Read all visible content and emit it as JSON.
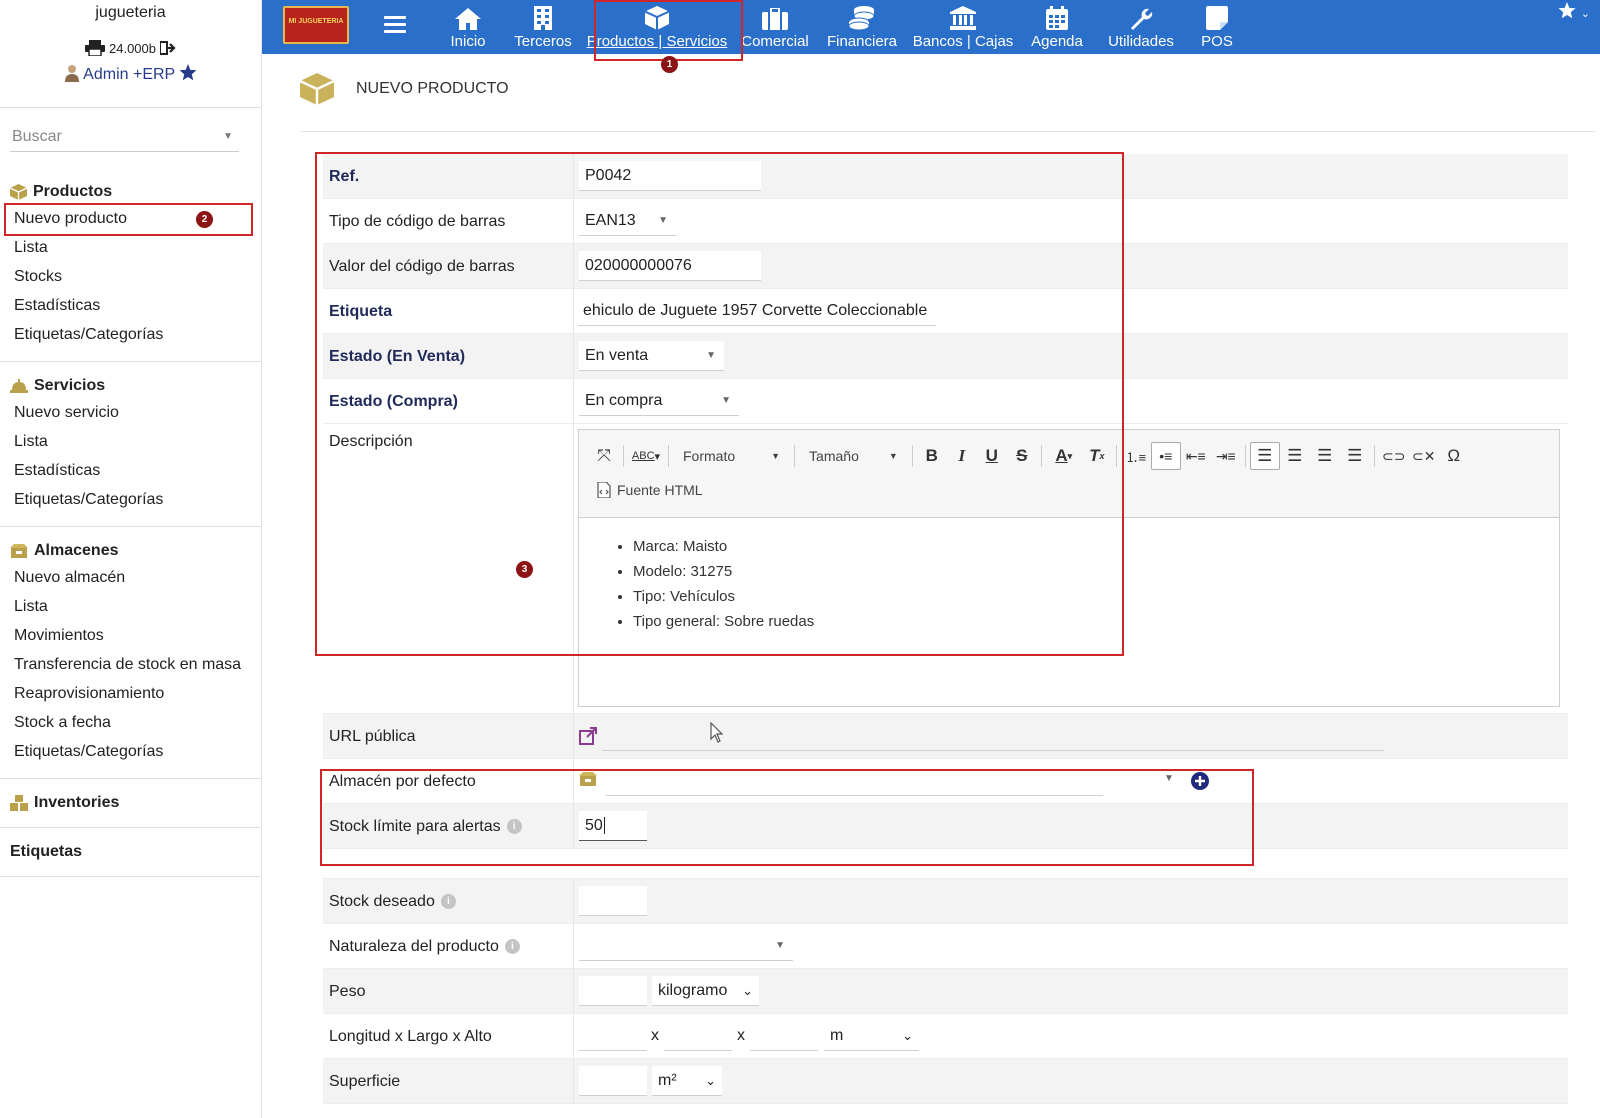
{
  "sidebar": {
    "company": "jugueteria",
    "balance": "24.000b",
    "user": "Admin +ERP",
    "search_placeholder": "Buscar",
    "sections": [
      {
        "title": "Productos",
        "icon": "box-icon",
        "items": [
          "Nuevo producto",
          "Lista",
          "Stocks",
          "Estadísticas",
          "Etiquetas/Categorías"
        ]
      },
      {
        "title": "Servicios",
        "icon": "bell-service-icon",
        "items": [
          "Nuevo servicio",
          "Lista",
          "Estadísticas",
          "Etiquetas/Categorías"
        ]
      },
      {
        "title": "Almacenes",
        "icon": "warehouse-icon",
        "items": [
          "Nuevo almacén",
          "Lista",
          "Movimientos",
          "Transferencia de stock en masa",
          "Reaprovisionamiento",
          "Stock a fecha",
          "Etiquetas/Categorías"
        ]
      },
      {
        "title": "Inventories",
        "icon": "boxes-icon",
        "items": []
      },
      {
        "title": "Etiquetas",
        "icon": "",
        "items": []
      }
    ]
  },
  "topbar": {
    "logo_text": "MI JUGUETERIA",
    "nav": [
      {
        "label": "Inicio",
        "icon": "home-icon"
      },
      {
        "label": "Terceros",
        "icon": "building-icon"
      },
      {
        "label": "Productos | Servicios",
        "icon": "cube-icon"
      },
      {
        "label": "Comercial",
        "icon": "briefcase-icon"
      },
      {
        "label": "Financiera",
        "icon": "coins-icon"
      },
      {
        "label": "Bancos | Cajas",
        "icon": "bank-icon"
      },
      {
        "label": "Agenda",
        "icon": "calendar-icon"
      },
      {
        "label": "Utilidades",
        "icon": "wrench-icon"
      },
      {
        "label": "POS",
        "icon": "pos-icon"
      }
    ]
  },
  "annotations": {
    "badge1": "1",
    "badge2": "2",
    "badge3": "3"
  },
  "page": {
    "title": "NUEVO PRODUCTO"
  },
  "form": {
    "ref_label": "Ref.",
    "ref_value": "P0042",
    "barcode_type_label": "Tipo de código de barras",
    "barcode_type_value": "EAN13",
    "barcode_value_label": "Valor del código de barras",
    "barcode_value": "020000000076",
    "etiqueta_label": "Etiqueta",
    "etiqueta_value": "ehiculo de Juguete 1957 Corvette Coleccionable",
    "estado_venta_label": "Estado (En Venta)",
    "estado_venta_value": "En venta",
    "estado_compra_label": "Estado (Compra)",
    "estado_compra_value": "En compra",
    "descripcion_label": "Descripción",
    "editor": {
      "format_label": "Formato",
      "size_label": "Tamaño",
      "html_source_label": "Fuente HTML",
      "bullets": [
        "Marca: Maisto",
        "Modelo: 31275",
        "Tipo: Vehículos",
        "Tipo general: Sobre ruedas"
      ]
    },
    "url_label": "URL pública",
    "almacen_label": "Almacén por defecto",
    "stock_limite_label": "Stock límite para alertas",
    "stock_limite_value": "50",
    "stock_deseado_label": "Stock deseado",
    "naturaleza_label": "Naturaleza del producto",
    "peso_label": "Peso",
    "peso_unit": "kilogramo",
    "dim_label": "Longitud x Largo x Alto",
    "dim_sep": "x",
    "dim_unit": "m",
    "superficie_label": "Superficie",
    "superficie_unit": "m²"
  }
}
